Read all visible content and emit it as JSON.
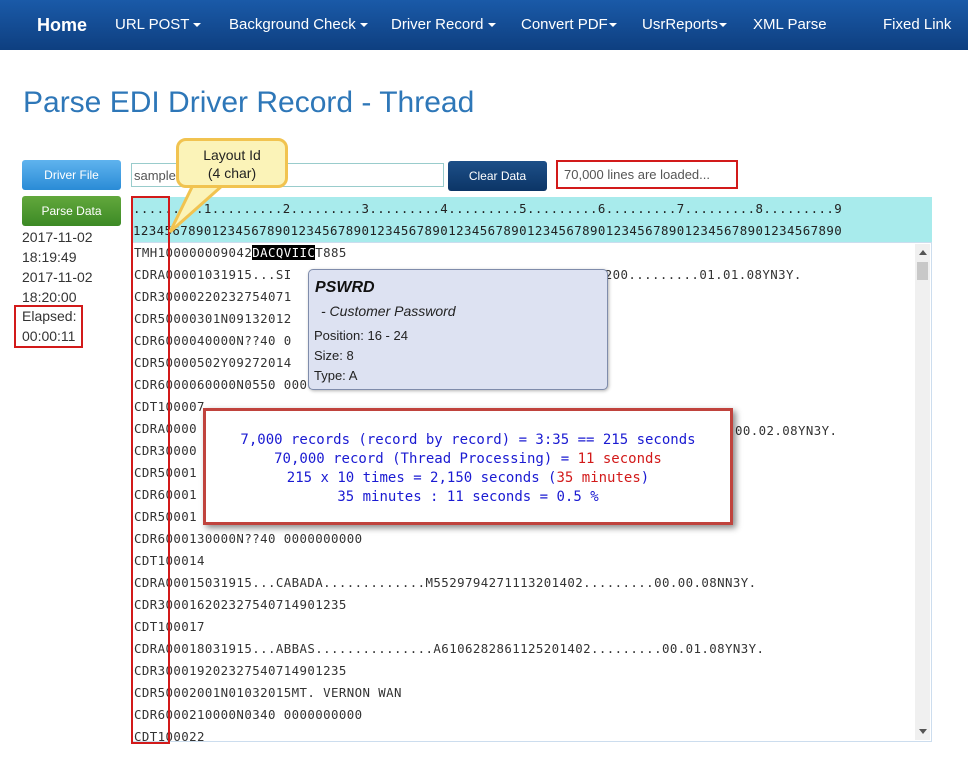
{
  "nav": {
    "home": "Home",
    "items": [
      "URL POST",
      "Background Check",
      "Driver Record",
      "Convert PDF",
      "UsrReports",
      "XML Parse",
      "Fixed Link"
    ]
  },
  "page_title": "Parse EDI Driver Record - Thread",
  "buttons": {
    "driver_file": "Driver File",
    "parse_data": "Parse Data",
    "clear_data": "Clear Data"
  },
  "file_input": {
    "value": "sample"
  },
  "status": "70,000 lines are loaded...",
  "sidebar": {
    "start_date": "2017-11-02",
    "start_time": "18:19:49",
    "end_date": "2017-11-02",
    "end_time": "18:20:00",
    "elapsed_label": "Elapsed:",
    "elapsed_value": "00:00:11"
  },
  "ruler": {
    "line1": ".........1.........2.........3.........4.........5.........6.........7.........8.........9",
    "line2": "123456789012345678901234567890123456789012345678901234567890123456789012345678901234567890"
  },
  "data_lines": [
    {
      "pre": "TMH100000009042",
      "hl": "DACQVIIC",
      "post": "T885"
    },
    {
      "pre": "CDRA00001031915...SI",
      "hl": "",
      "post": ""
    },
    {
      "pre": "CDR30000220232754071",
      "hl": "",
      "post": ""
    },
    {
      "pre": "CDR50000301N09132012",
      "hl": "",
      "post": ""
    },
    {
      "pre": "CDR6000040000N??40 0",
      "hl": "",
      "post": ""
    },
    {
      "pre": "CDR50000502Y09272014",
      "hl": "",
      "post": ""
    },
    {
      "pre": "CDR6000060000N0550 0000000000",
      "hl": "",
      "post": ""
    },
    {
      "pre": "CDT100007",
      "hl": "",
      "post": ""
    },
    {
      "pre": "CDRA0000",
      "hl": "",
      "post": ""
    },
    {
      "pre": "CDR30000",
      "hl": "",
      "post": ""
    },
    {
      "pre": "CDR50001",
      "hl": "",
      "post": ""
    },
    {
      "pre": "CDR60001",
      "hl": "",
      "post": ""
    },
    {
      "pre": "CDR50001",
      "hl": "",
      "post": ""
    },
    {
      "pre": "CDR6000130000N??40 0000000000",
      "hl": "",
      "post": ""
    },
    {
      "pre": "CDT100014",
      "hl": "",
      "post": ""
    },
    {
      "pre": "CDRA00015031915...CABADA.............M5529794271113201402.........00.00.08NN3Y.",
      "hl": "",
      "post": ""
    },
    {
      "pre": "CDR30001620232754071490123",
      "hl": "5",
      "post": ""
    },
    {
      "pre": "CDT100017",
      "hl": "",
      "post": ""
    },
    {
      "pre": "CDRA00018031915...ABBAS...............A6106282861125201402.........00.01.08YN3Y.",
      "hl": "",
      "post": ""
    },
    {
      "pre": "CDR3000192023275407149012",
      "hl": "",
      "post": "35"
    },
    {
      "pre": "CDR50002001N01032015MT. VERNON WAN",
      "hl": "",
      "post": ""
    },
    {
      "pre": "CDR6000210000N0340 0000000000",
      "hl": "",
      "post": ""
    },
    {
      "pre": "CDT100022",
      "hl": "",
      "post": ""
    }
  ],
  "right_fragments": {
    "line2": "01200.........01.01.08YN3Y.",
    "line9": "00.02.08YN3Y."
  },
  "tooltip": {
    "title": "PSWRD",
    "description": "- Customer Password",
    "position": "Position: 16 - 24",
    "size": "Size: 8",
    "type": "Type: A"
  },
  "callout": {
    "line1": "Layout Id",
    "line2": "(4 char)"
  },
  "note": {
    "line1": "7,000 records (record by record) = 3:35 == 215 seconds",
    "line2_a": "70,000 record (Thread Processing) = ",
    "line2_b": "11 seconds",
    "line3_a": "215 x 10 times = 2,150 seconds (",
    "line3_b": "35 minutes",
    "line3_c": ")",
    "line4": "35 minutes : 11 seconds = 0.5 %"
  },
  "colors": {
    "nav_bg": "#0e3f80",
    "title": "#2e77b8",
    "highlight_red": "#d21a1a",
    "ruler_bg": "#a8ebec",
    "note_text": "#1a1ad2"
  }
}
